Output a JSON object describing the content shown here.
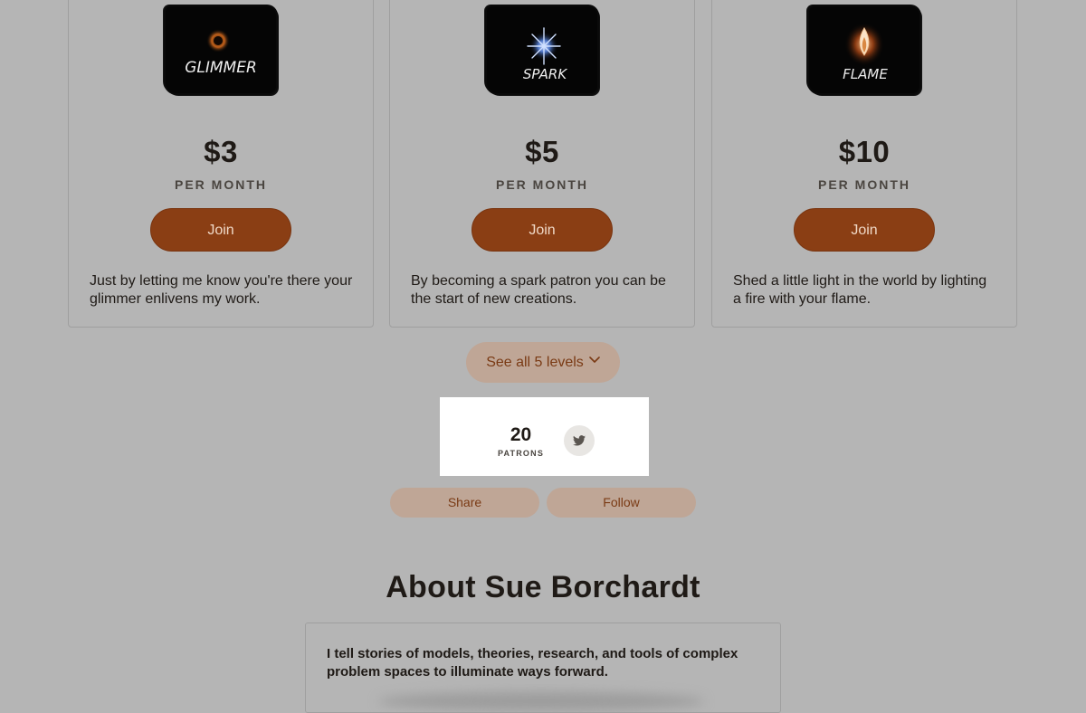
{
  "tiers": [
    {
      "image_text": "GLIMMER",
      "price": "$3",
      "period": "PER MONTH",
      "join_label": "Join",
      "description": "Just by letting me know you're there your glimmer enlivens my work."
    },
    {
      "image_text": "SPARK",
      "price": "$5",
      "period": "PER MONTH",
      "join_label": "Join",
      "description": "By becoming a spark patron you can be the start of new creations."
    },
    {
      "image_text": "FLAME",
      "price": "$10",
      "period": "PER MONTH",
      "join_label": "Join",
      "description": "Shed a little light in the world by lighting a fire with your flame."
    }
  ],
  "see_all": {
    "label": "See all 5 levels",
    "icon": "chevron-down-icon"
  },
  "patrons": {
    "count": "20",
    "label": "PATRONS",
    "social_icon": "twitter-icon"
  },
  "actions": {
    "share_label": "Share",
    "follow_label": "Follow"
  },
  "about": {
    "title": "About Sue Borchardt",
    "text": "I tell stories of models, theories, research, and tools of complex problem spaces to illuminate ways forward."
  },
  "colors": {
    "page_background": "#b5b5b5",
    "accent": "#8a3e14",
    "accent_text": "#f0d9c7",
    "soft_button": "#bfa696",
    "soft_button_text": "#7a3a14"
  }
}
